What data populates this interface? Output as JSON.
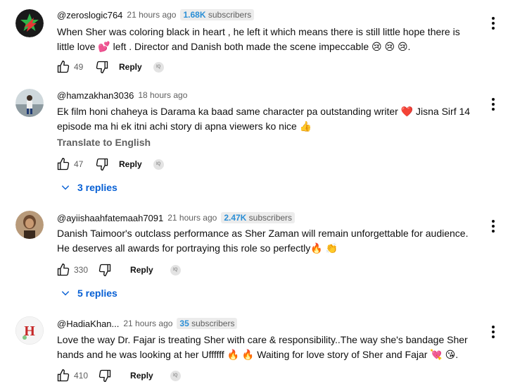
{
  "comments": [
    {
      "author": "@zeroslogic764",
      "time": "21 hours ago",
      "subs_count": "1.68K",
      "subs_label": " subscribers",
      "lines": [
        "When Sher was coloring black  in heart , he left it which means there is still little hope there is",
        "little love 💕  left . Director and Danish both made the scene impeccable 😢 😢 😢."
      ],
      "likes": "49",
      "reply_label": "Reply",
      "ext_label": "IQ"
    },
    {
      "author": "@hamzakhan3036",
      "time": "18 hours ago",
      "lines": [
        "Ek film honi chaheya is Darama ka baad same character pa outstanding writer ❤️ Jisna Sirf 14",
        "episode ma hi ek itni achi story di apna viewers ko nice 👍"
      ],
      "translate": "Translate to English",
      "likes": "47",
      "reply_label": "Reply",
      "ext_label": "IQ",
      "replies": "3 replies"
    },
    {
      "author": "@ayiishaahfatemaah7091",
      "time": "21 hours ago",
      "subs_count": "2.47K",
      "subs_label": " subscribers",
      "lines": [
        "Danish Taimoor's outclass performance as Sher Zaman will remain unforgettable for audience.",
        "He deserves all awards for portraying this role so perfectly🔥 👏"
      ],
      "likes": "330",
      "reply_label": "Reply",
      "ext_label": "IQ",
      "replies": "5 replies"
    },
    {
      "author": "@HadiaKhan...",
      "time": "21 hours ago",
      "subs_count": "35",
      "subs_label": " subscribers",
      "lines": [
        "Love the way Dr. Fajar is treating Sher with care & responsibility..The way she's bandage Sher",
        "hands and he was looking at her Uffffff 🔥 🔥 Waiting for love story of Sher and Fajar 💘 😘."
      ],
      "likes": "410",
      "reply_label": "Reply",
      "ext_label": "IQ"
    }
  ],
  "colors": {
    "link_blue": "#065fd4",
    "subs_blue": "#2b8fd6",
    "muted": "#606060"
  }
}
